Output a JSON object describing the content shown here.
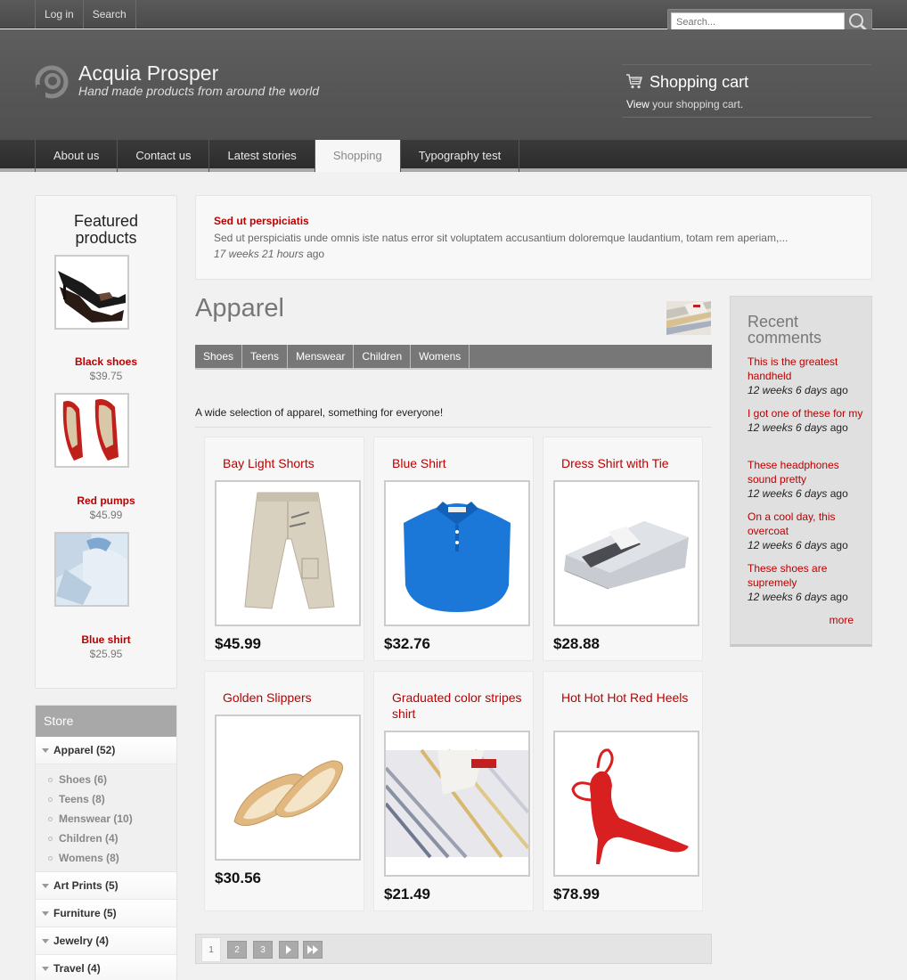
{
  "topbar": {
    "links": [
      "Log in",
      "Search"
    ],
    "search_placeholder": "Search..."
  },
  "header": {
    "site_name": "Acquia Prosper",
    "slogan": "Hand made products from around the world",
    "cart_title": "Shopping cart",
    "cart_view": "View",
    "cart_text": " your shopping cart."
  },
  "nav": {
    "items": [
      "About us",
      "Contact us",
      "Latest stories",
      "Shopping",
      "Typography test"
    ],
    "active": "Shopping"
  },
  "featured": {
    "title": "Featured products",
    "items": [
      {
        "name": "Black shoes",
        "price": "$39.75",
        "image": "black-shoes-image"
      },
      {
        "name": "Red pumps",
        "price": "$45.99",
        "image": "red-pumps-image"
      },
      {
        "name": "Blue shirt",
        "price": "$25.95",
        "image": "blue-shirt-image"
      }
    ]
  },
  "store": {
    "title": "Store",
    "categories": [
      {
        "label": "Apparel (52)",
        "children": [
          "Shoes (6)",
          "Teens (8)",
          "Menswear (10)",
          "Children (4)",
          "Womens (8)"
        ]
      },
      {
        "label": "Art Prints (5)"
      },
      {
        "label": "Furniture (5)"
      },
      {
        "label": "Jewelry (4)"
      },
      {
        "label": "Travel (4)"
      }
    ]
  },
  "story": {
    "title": "Sed ut perspiciatis",
    "excerpt": "Sed ut perspiciatis unde omnis iste natus error sit voluptatem accusantium doloremque laudantium, totam rem aperiam,...",
    "age": "17 weeks 21 hours",
    "age_suffix": " ago"
  },
  "category": {
    "title": "Apparel",
    "tabs": [
      "Shoes",
      "Teens",
      "Menswear",
      "Children",
      "Womens"
    ],
    "description": "A wide selection of apparel, something for everyone!"
  },
  "products": [
    {
      "name": "Bay Light Shorts",
      "price": "$45.99"
    },
    {
      "name": "Blue Shirt",
      "price": "$32.76"
    },
    {
      "name": "Dress Shirt with Tie",
      "price": "$28.88"
    },
    {
      "name": "Golden Slippers",
      "price": "$30.56"
    },
    {
      "name": "Graduated color stripes shirt",
      "price": "$21.49"
    },
    {
      "name": "Hot Hot Hot Red Heels",
      "price": "$78.99"
    }
  ],
  "recent": {
    "title": "Recent comments",
    "items": [
      {
        "text": "This is the greatest handheld",
        "age": "12 weeks 6 days",
        "suffix": " ago"
      },
      {
        "text": "I got one of these for my",
        "age": "12 weeks 6 days",
        "suffix": " ago"
      },
      {
        "text": "These headphones sound pretty",
        "age": "12 weeks 6 days",
        "suffix": " ago"
      },
      {
        "text": "On a cool day, this overcoat",
        "age": "12 weeks 6 days",
        "suffix": " ago"
      },
      {
        "text": "These shoes are supremely",
        "age": "12 weeks 6 days",
        "suffix": " ago"
      }
    ],
    "more": "more"
  },
  "pager": {
    "current": "1",
    "pages": [
      "2",
      "3"
    ]
  },
  "colors": {
    "accent_red": "#bb0000",
    "header_gray": "#555555",
    "nav_dark": "#333333"
  }
}
